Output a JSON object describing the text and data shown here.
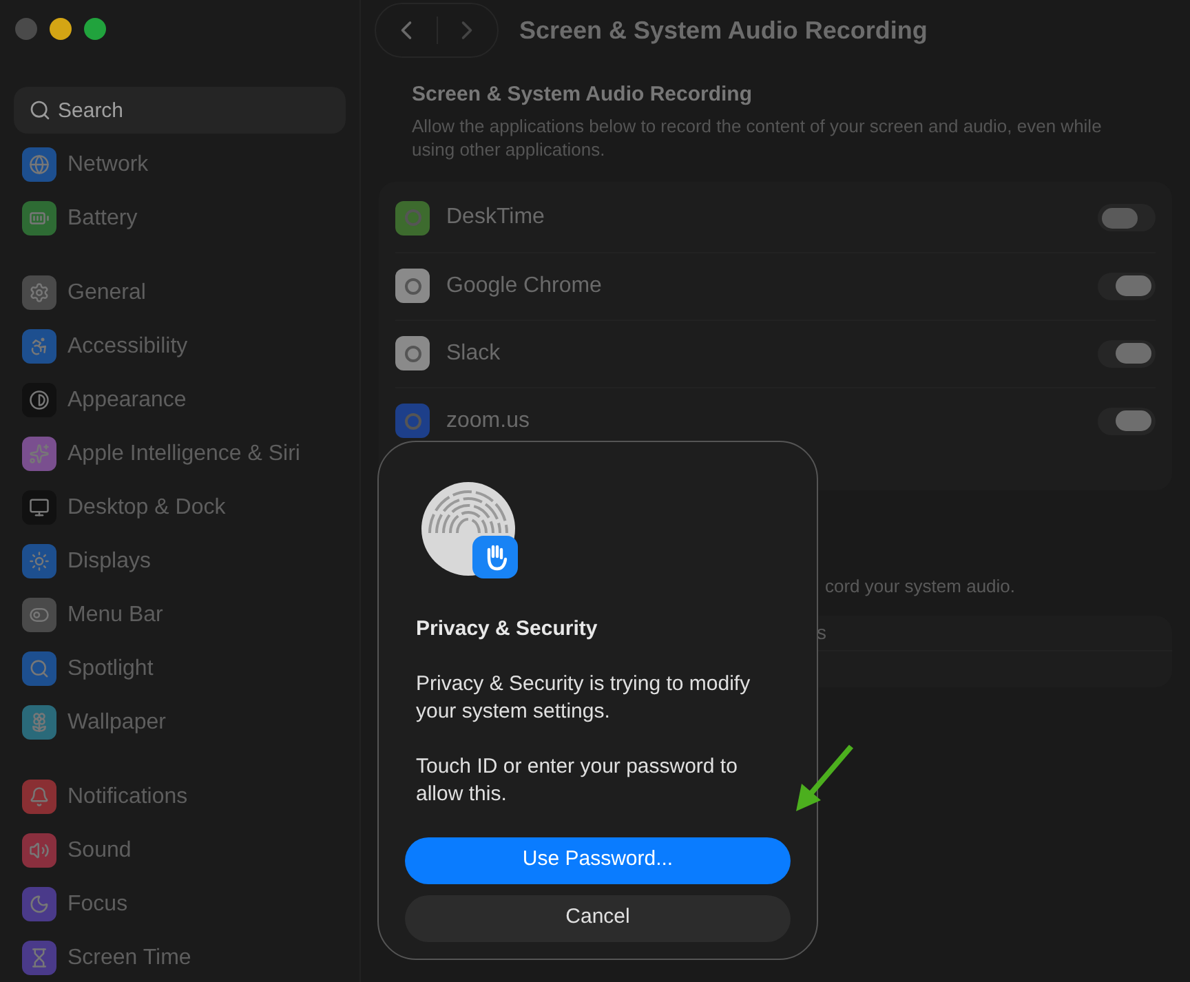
{
  "sidebar": {
    "search": {
      "placeholder": "Search"
    },
    "groups": [
      [
        {
          "label": "Network",
          "color": "#1d4f8f"
        },
        {
          "label": "Battery",
          "color": "#2e6b34"
        }
      ],
      [
        {
          "label": "General",
          "color": "#4a4a4a"
        },
        {
          "label": "Accessibility",
          "color": "#1d4f8f"
        },
        {
          "label": "Appearance",
          "color": "#111111"
        },
        {
          "label": "Apple Intelligence & Siri",
          "color": "#7a4f8f"
        },
        {
          "label": "Desktop & Dock",
          "color": "#111111"
        },
        {
          "label": "Displays",
          "color": "#1d4f8f"
        },
        {
          "label": "Menu Bar",
          "color": "#4a4a4a"
        },
        {
          "label": "Spotlight",
          "color": "#1d4f8f"
        },
        {
          "label": "Wallpaper",
          "color": "#2a6a7a"
        }
      ],
      [
        {
          "label": "Notifications",
          "color": "#8a2f33"
        },
        {
          "label": "Sound",
          "color": "#8a2f3e"
        },
        {
          "label": "Focus",
          "color": "#4a3a8a"
        },
        {
          "label": "Screen Time",
          "color": "#4a3a8a"
        }
      ]
    ]
  },
  "window": {
    "title": "Screen & System Audio Recording"
  },
  "section": {
    "heading": "Screen & System Audio Recording",
    "description": "Allow the applications below to record the content of your screen and audio, even while using other applications.",
    "apps": [
      {
        "name": "DeskTime",
        "on": false
      },
      {
        "name": "Google Chrome",
        "on": true
      },
      {
        "name": "Slack",
        "on": true
      },
      {
        "name": "zoom.us",
        "on": true
      }
    ]
  },
  "section_2": {
    "description": "cord your system audio.",
    "row_text": "s"
  },
  "dialog": {
    "title": "Privacy & Security",
    "message": "Privacy & Security is trying to modify your system settings.",
    "prompt": "Touch ID or enter your password to allow this.",
    "buttons": [
      {
        "label": "Use Password...",
        "kind": "primary"
      },
      {
        "label": "Cancel",
        "kind": "secondary"
      }
    ]
  }
}
